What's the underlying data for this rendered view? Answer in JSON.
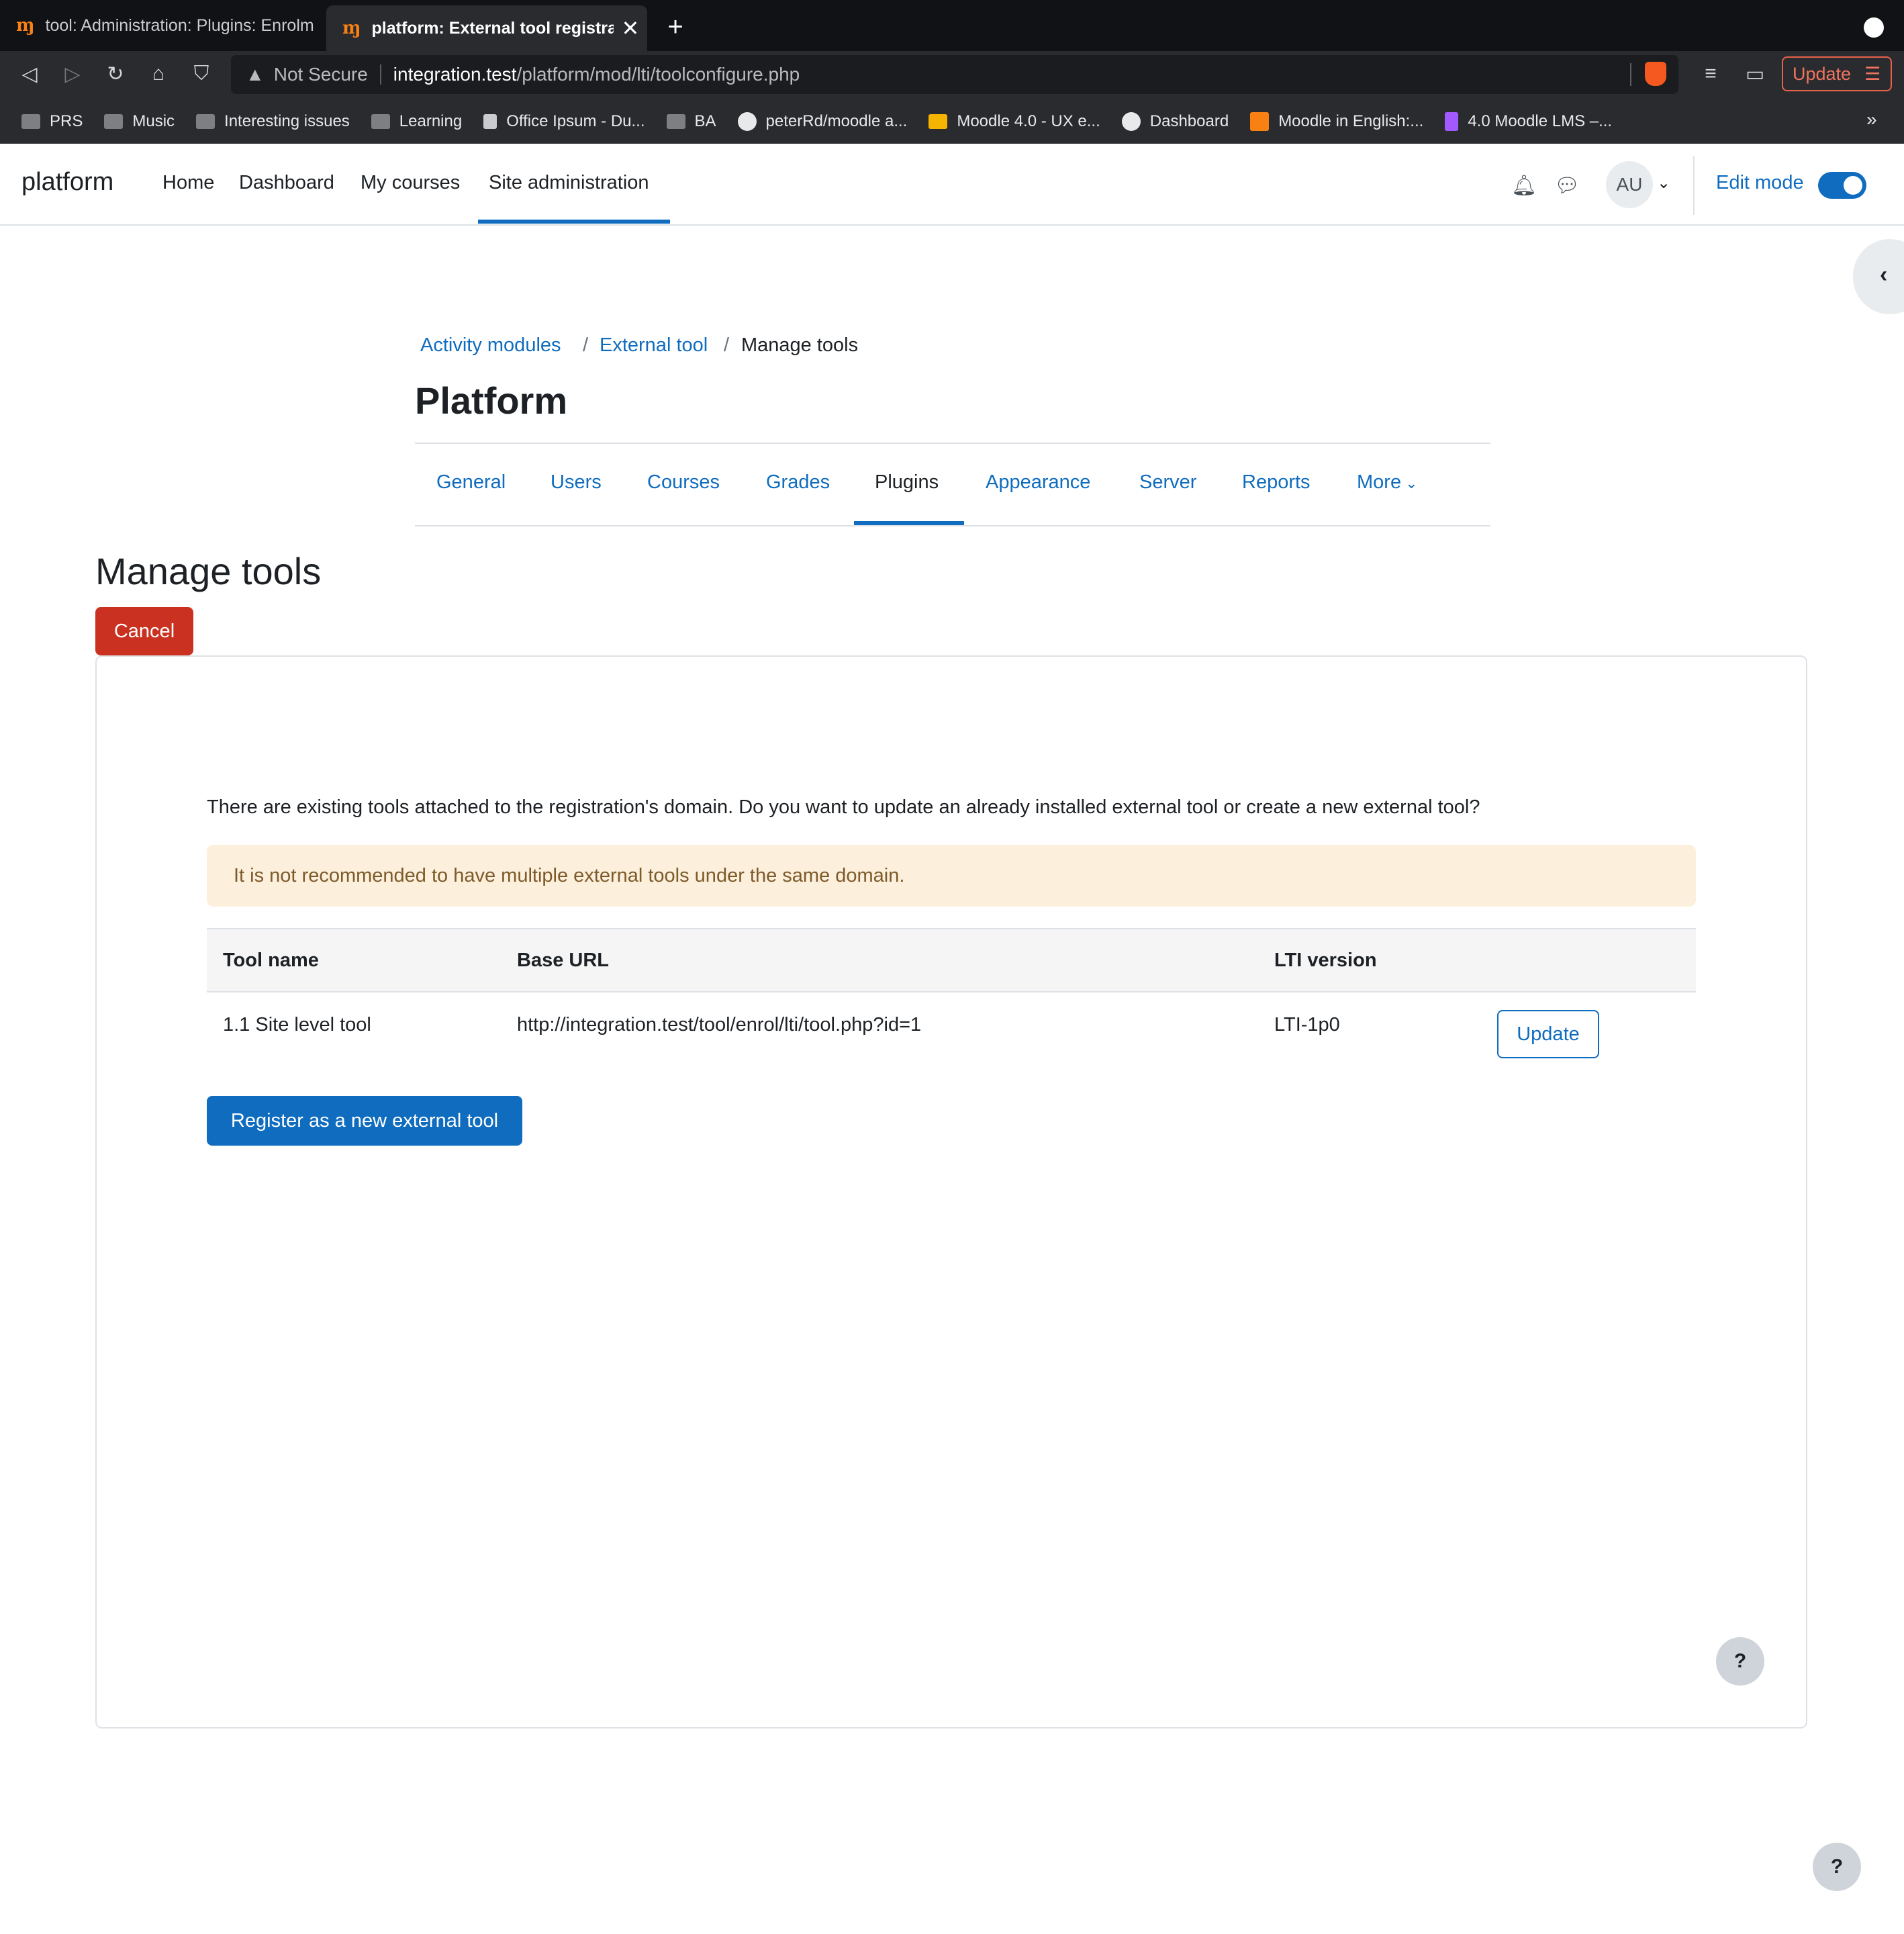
{
  "browser": {
    "tabs": [
      {
        "title": "tool: Administration: Plugins: Enrolm"
      },
      {
        "title": "platform: External tool registrat"
      }
    ],
    "url_warning": "Not Secure",
    "url_host": "integration.test",
    "url_path": "/platform/mod/lti/toolconfigure.php",
    "update_label": "Update",
    "bookmarks": [
      {
        "label": "PRS"
      },
      {
        "label": "Music"
      },
      {
        "label": "Interesting issues"
      },
      {
        "label": "Learning"
      },
      {
        "label": "Office Ipsum - Du..."
      },
      {
        "label": "BA"
      },
      {
        "label": "peterRd/moodle a..."
      },
      {
        "label": "Moodle 4.0 - UX e..."
      },
      {
        "label": "Dashboard"
      },
      {
        "label": "Moodle in English:..."
      },
      {
        "label": "4.0 Moodle LMS –..."
      }
    ],
    "more_bookmarks": "»"
  },
  "navbar": {
    "brand": "platform",
    "links": [
      "Home",
      "Dashboard",
      "My courses",
      "Site administration"
    ],
    "avatar_initials": "AU",
    "edit_mode_label": "Edit mode",
    "edit_mode_on": true
  },
  "breadcrumb": {
    "items": [
      "Activity modules",
      "External tool",
      "Manage tools"
    ],
    "separator": "/"
  },
  "page_heading": "Platform",
  "secondary_nav": {
    "tabs": [
      "General",
      "Users",
      "Courses",
      "Grades",
      "Plugins",
      "Appearance",
      "Server",
      "Reports",
      "More"
    ],
    "active": "Plugins"
  },
  "main": {
    "title": "Manage tools",
    "cancel_label": "Cancel",
    "intro": "There are existing tools attached to the registration's domain. Do you want to update an already installed external tool or create a new external tool?",
    "warning": "It is not recommended to have multiple external tools under the same domain.",
    "table": {
      "headers": [
        "Tool name",
        "Base URL",
        "LTI version"
      ],
      "rows": [
        {
          "name": "1.1 Site level tool",
          "url": "http://integration.test/tool/enrol/lti/tool.php?id=1",
          "version": "LTI-1p0",
          "action": "Update"
        }
      ]
    },
    "register_label": "Register as a new external tool"
  },
  "help_label": "?",
  "colors": {
    "primary": "#0f6cbf",
    "danger": "#ca3120",
    "warning_bg": "#fcefdc",
    "warning_text": "#7d5a29"
  }
}
